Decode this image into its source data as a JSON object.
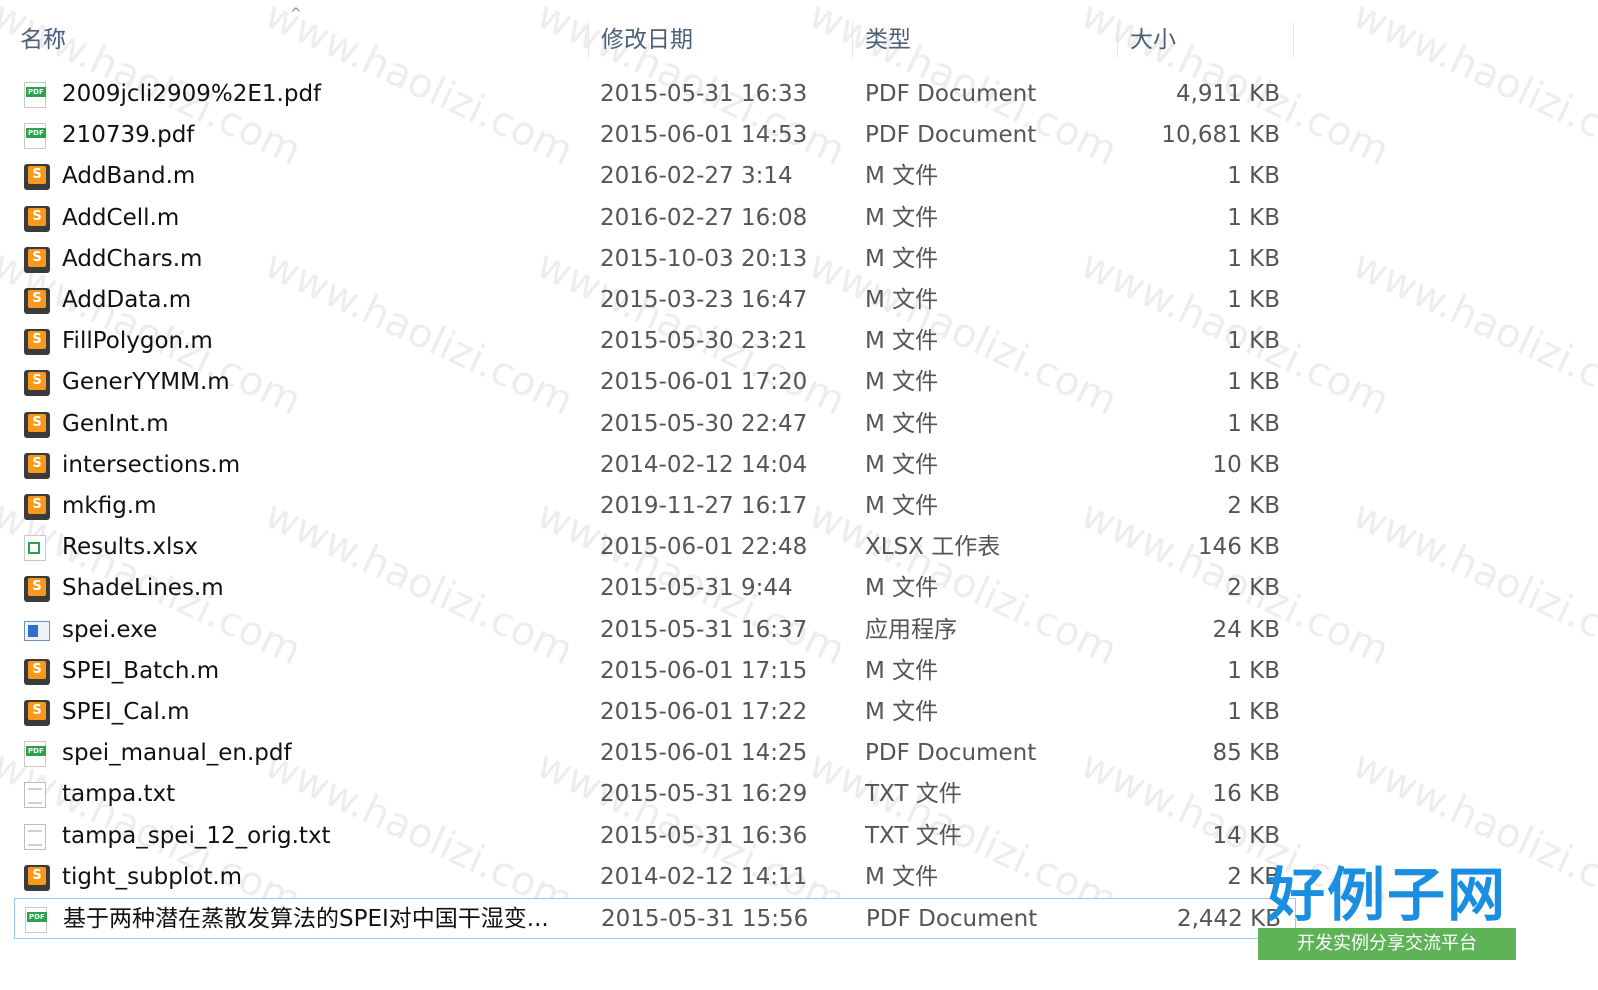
{
  "header": {
    "name": "名称",
    "date": "修改日期",
    "type": "类型",
    "size": "大小",
    "sort_arrow": "^"
  },
  "files": [
    {
      "icon": "pdf-icon",
      "name": "2009jcli2909%2E1.pdf",
      "date": "2015-05-31 16:33",
      "type": "PDF Document",
      "size": "4,911 KB"
    },
    {
      "icon": "pdf-icon",
      "name": "210739.pdf",
      "date": "2015-06-01 14:53",
      "type": "PDF Document",
      "size": "10,681 KB"
    },
    {
      "icon": "matlab-file-icon",
      "name": "AddBand.m",
      "date": "2016-02-27 3:14",
      "type": "M 文件",
      "size": "1 KB"
    },
    {
      "icon": "matlab-file-icon",
      "name": "AddCell.m",
      "date": "2016-02-27 16:08",
      "type": "M 文件",
      "size": "1 KB"
    },
    {
      "icon": "matlab-file-icon",
      "name": "AddChars.m",
      "date": "2015-10-03 20:13",
      "type": "M 文件",
      "size": "1 KB"
    },
    {
      "icon": "matlab-file-icon",
      "name": "AddData.m",
      "date": "2015-03-23 16:47",
      "type": "M 文件",
      "size": "1 KB"
    },
    {
      "icon": "matlab-file-icon",
      "name": "FillPolygon.m",
      "date": "2015-05-30 23:21",
      "type": "M 文件",
      "size": "1 KB"
    },
    {
      "icon": "matlab-file-icon",
      "name": "GenerYYMM.m",
      "date": "2015-06-01 17:20",
      "type": "M 文件",
      "size": "1 KB"
    },
    {
      "icon": "matlab-file-icon",
      "name": "GenInt.m",
      "date": "2015-05-30 22:47",
      "type": "M 文件",
      "size": "1 KB"
    },
    {
      "icon": "matlab-file-icon",
      "name": "intersections.m",
      "date": "2014-02-12 14:04",
      "type": "M 文件",
      "size": "10 KB"
    },
    {
      "icon": "matlab-file-icon",
      "name": "mkfig.m",
      "date": "2019-11-27 16:17",
      "type": "M 文件",
      "size": "2 KB"
    },
    {
      "icon": "xlsx-icon",
      "name": "Results.xlsx",
      "date": "2015-06-01 22:48",
      "type": "XLSX 工作表",
      "size": "146 KB"
    },
    {
      "icon": "matlab-file-icon",
      "name": "ShadeLines.m",
      "date": "2015-05-31 9:44",
      "type": "M 文件",
      "size": "2 KB"
    },
    {
      "icon": "exe-icon",
      "name": "spei.exe",
      "date": "2015-05-31 16:37",
      "type": "应用程序",
      "size": "24 KB"
    },
    {
      "icon": "matlab-file-icon",
      "name": "SPEI_Batch.m",
      "date": "2015-06-01 17:15",
      "type": "M 文件",
      "size": "1 KB"
    },
    {
      "icon": "matlab-file-icon",
      "name": "SPEI_Cal.m",
      "date": "2015-06-01 17:22",
      "type": "M 文件",
      "size": "1 KB"
    },
    {
      "icon": "pdf-icon",
      "name": "spei_manual_en.pdf",
      "date": "2015-06-01 14:25",
      "type": "PDF Document",
      "size": "85 KB"
    },
    {
      "icon": "txt-icon",
      "name": "tampa.txt",
      "date": "2015-05-31 16:29",
      "type": "TXT 文件",
      "size": "16 KB"
    },
    {
      "icon": "txt-icon",
      "name": "tampa_spei_12_orig.txt",
      "date": "2015-05-31 16:36",
      "type": "TXT 文件",
      "size": "14 KB"
    },
    {
      "icon": "matlab-file-icon",
      "name": "tight_subplot.m",
      "date": "2014-02-12 14:11",
      "type": "M 文件",
      "size": "2 KB"
    },
    {
      "icon": "pdf-icon",
      "name": "基于两种潜在蒸散发算法的SPEI对中国干湿变...",
      "date": "2015-05-31 15:56",
      "type": "PDF Document",
      "size": "2,442 KB",
      "selected": true
    }
  ],
  "watermark": "www.haolizi.com",
  "logo": {
    "title": "好例子网",
    "subtitle": "开发实例分享交流平台"
  }
}
